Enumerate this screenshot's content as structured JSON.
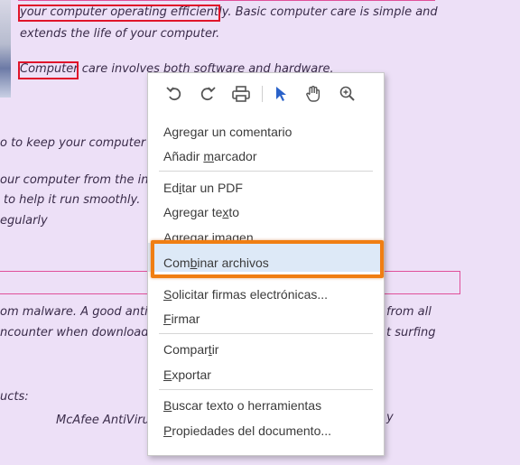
{
  "document": {
    "lines": [
      {
        "key": "l1",
        "text": "your computer operating efficiently.  Basic computer care is simple and"
      },
      {
        "key": "l2",
        "text": "extends the life of your computer."
      },
      {
        "key": "l3",
        "text": "Computer care involves both software and hardware."
      },
      {
        "key": "l4",
        "text": "o to keep your computer r"
      },
      {
        "key": "l5",
        "text": "our computer from the ins"
      },
      {
        "key": "l6",
        "text": "to help it run smoothly."
      },
      {
        "key": "l7",
        "text": "egularly"
      },
      {
        "key": "l8",
        "text": "om malware.  A good anti"
      },
      {
        "key": "l9",
        "text": "ncounter when downloadin"
      },
      {
        "key": "l10",
        "text": "from all"
      },
      {
        "key": "l11",
        "text": "t surfing"
      },
      {
        "key": "l12",
        "text": "ucts:"
      },
      {
        "key": "l13",
        "text": "McAfee AntiViru"
      },
      {
        "key": "l14",
        "text": "y"
      }
    ]
  },
  "menu": {
    "toolbar_icons": [
      "undo-icon",
      "redo-icon",
      "print-icon",
      "select-arrow-icon",
      "hand-tool-icon",
      "zoom-in-icon"
    ],
    "items": {
      "add_comment": "Agregar un comentario",
      "add_bookmark_pre": "Añadir ",
      "add_bookmark_u": "m",
      "add_bookmark_post": "arcador",
      "edit_pdf_pre": "Ed",
      "edit_pdf_u": "i",
      "edit_pdf_post": "tar un PDF",
      "add_text_pre": "Agregar te",
      "add_text_u": "x",
      "add_text_post": "to",
      "add_image": "Agregar imagen",
      "combine_pre": "Com",
      "combine_u": "b",
      "combine_post": "inar archivos",
      "request_sig_u": "S",
      "request_sig_post": "olicitar firmas electrónicas...",
      "sign_u": "F",
      "sign_post": "irmar",
      "share_pre": "Compar",
      "share_u": "t",
      "share_post": "ir",
      "export_u": "E",
      "export_post": "xportar",
      "search_u": "B",
      "search_post": "uscar texto o herramientas",
      "props_u": "P",
      "props_post": "ropiedades del documento..."
    }
  },
  "colors": {
    "page_bg": "#ede0f7",
    "highlight_border": "#f07e12",
    "red_box": "#e0142a",
    "pink_line": "#e0509a",
    "icon_blue": "#2a62c9"
  }
}
